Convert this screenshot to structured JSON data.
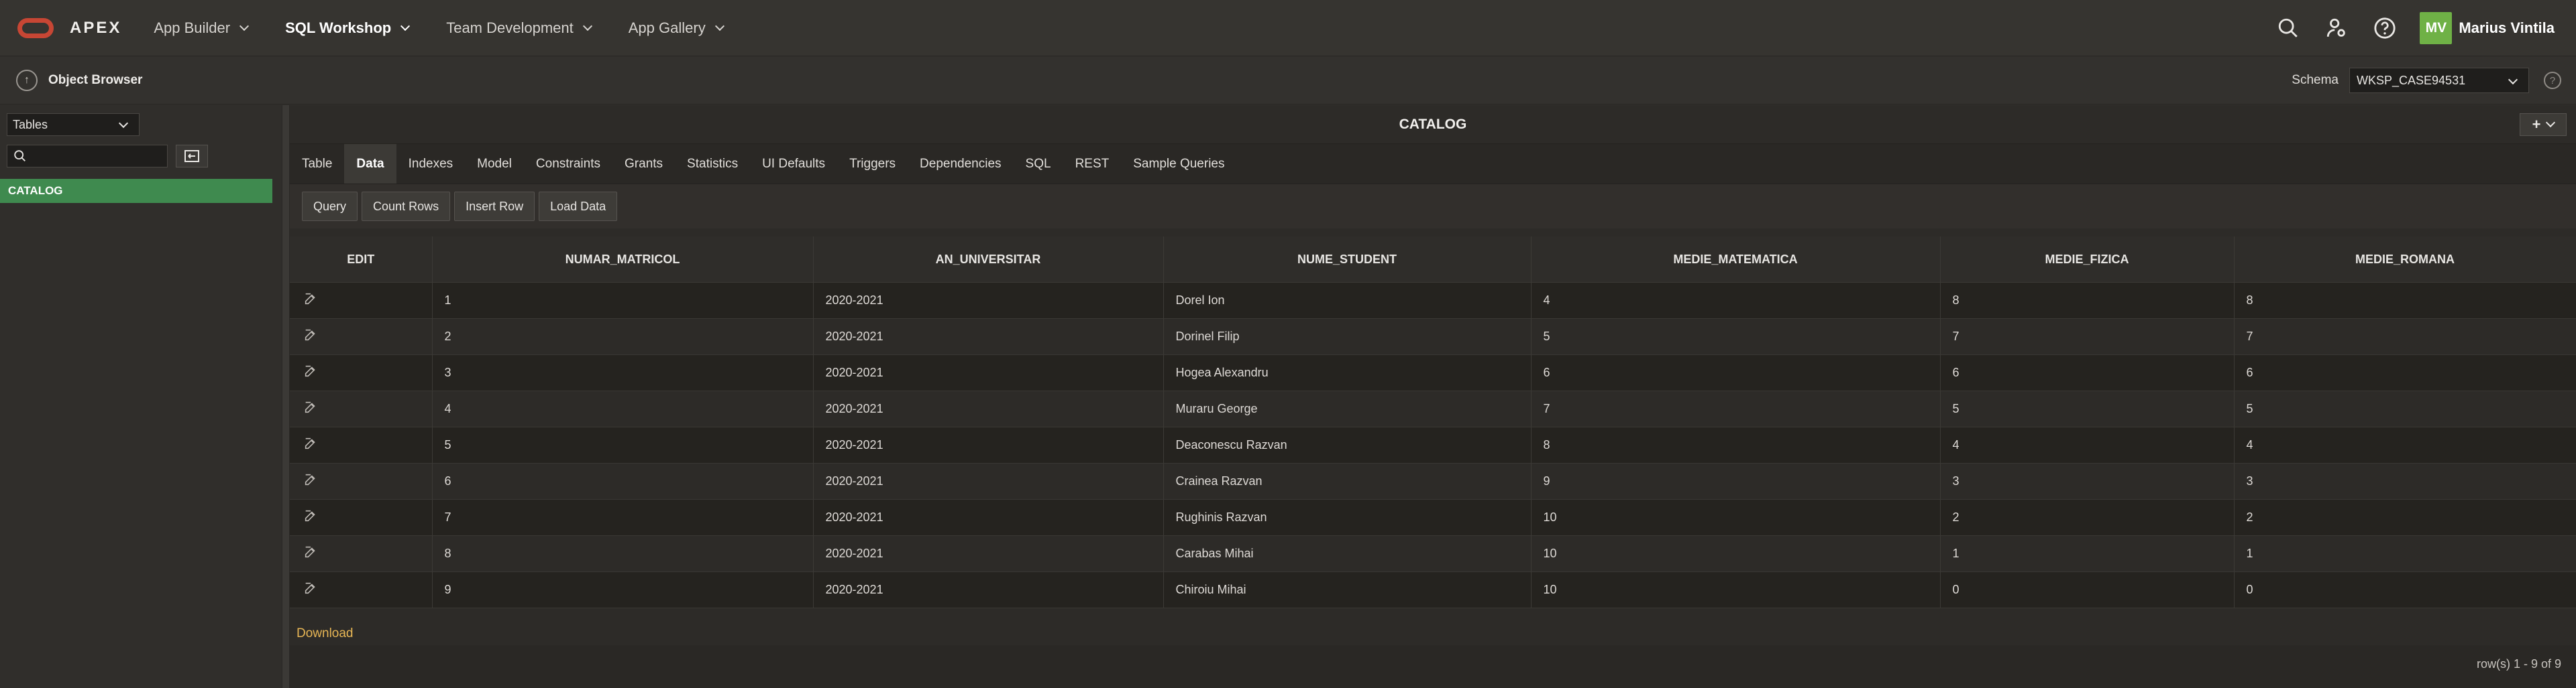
{
  "header": {
    "brand": "APEX",
    "nav": [
      {
        "label": "App Builder",
        "active": false
      },
      {
        "label": "SQL Workshop",
        "active": true
      },
      {
        "label": "Team Development",
        "active": false
      },
      {
        "label": "App Gallery",
        "active": false
      }
    ],
    "user_initials": "MV",
    "user_name": "Marius Vintila",
    "icons": [
      "search-icon",
      "user-settings-icon",
      "help-icon"
    ]
  },
  "breadcrumb": {
    "title": "Object Browser",
    "schema_label": "Schema",
    "schema_value": "WKSP_CASE94531"
  },
  "sidebar": {
    "object_type": "Tables",
    "search_placeholder": "",
    "items": [
      "CATALOG"
    ]
  },
  "main": {
    "object_title": "CATALOG",
    "tabs": [
      "Table",
      "Data",
      "Indexes",
      "Model",
      "Constraints",
      "Grants",
      "Statistics",
      "UI Defaults",
      "Triggers",
      "Dependencies",
      "SQL",
      "REST",
      "Sample Queries"
    ],
    "active_tab": "Data",
    "toolbar": [
      "Query",
      "Count Rows",
      "Insert Row",
      "Load Data"
    ],
    "columns": [
      "EDIT",
      "NUMAR_MATRICOL",
      "AN_UNIVERSITAR",
      "NUME_STUDENT",
      "MEDIE_MATEMATICA",
      "MEDIE_FIZICA",
      "MEDIE_ROMANA"
    ],
    "rows": [
      [
        "1",
        "2020-2021",
        "Dorel Ion",
        "4",
        "8",
        "8"
      ],
      [
        "2",
        "2020-2021",
        "Dorinel Filip",
        "5",
        "7",
        "7"
      ],
      [
        "3",
        "2020-2021",
        "Hogea Alexandru",
        "6",
        "6",
        "6"
      ],
      [
        "4",
        "2020-2021",
        "Muraru George",
        "7",
        "5",
        "5"
      ],
      [
        "5",
        "2020-2021",
        "Deaconescu Razvan",
        "8",
        "4",
        "4"
      ],
      [
        "6",
        "2020-2021",
        "Crainea Razvan",
        "9",
        "3",
        "3"
      ],
      [
        "7",
        "2020-2021",
        "Rughinis Razvan",
        "10",
        "2",
        "2"
      ],
      [
        "8",
        "2020-2021",
        "Carabas Mihai",
        "10",
        "1",
        "1"
      ],
      [
        "9",
        "2020-2021",
        "Chiroiu Mihai",
        "10",
        "0",
        "0"
      ]
    ],
    "download_label": "Download",
    "row_count_text": "row(s) 1 - 9 of 9"
  },
  "colors": {
    "accent_green": "#3f8a4f",
    "avatar_green": "#6fb146",
    "oracle_red": "#c74634",
    "link_gold": "#e7b655"
  }
}
